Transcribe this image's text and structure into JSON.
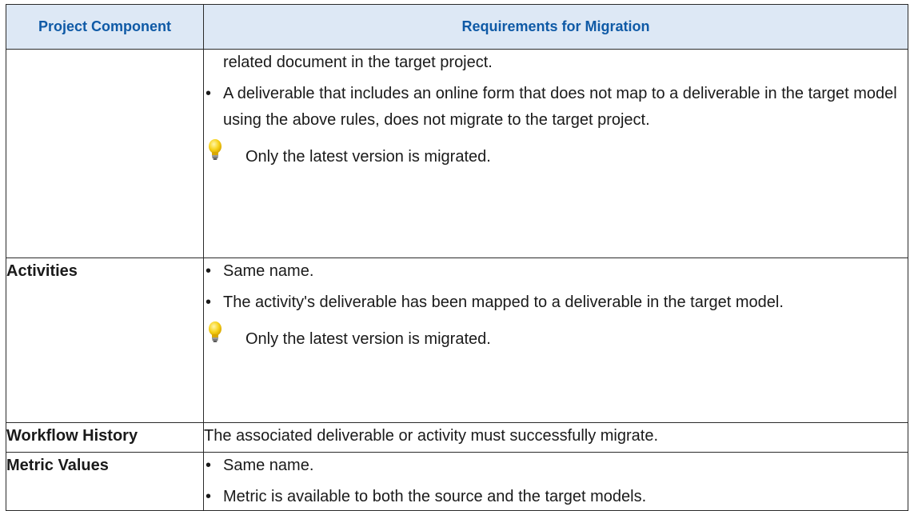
{
  "header": {
    "col_component": "Project Component",
    "col_requirements": "Requirements for Migration"
  },
  "rows": [
    {
      "component": "",
      "continued_text": "related document in the target project.",
      "bullets": [
        "A deliverable that includes an online form that does not map to a deliverable in the target model using the above rules, does not migrate to the target project."
      ],
      "tip": "Only the latest version is migrated."
    },
    {
      "component": "Activities",
      "bullets": [
        "Same name.",
        "The activity's deliverable has been mapped to a deliverable in the target model."
      ],
      "tip": "Only the latest version is migrated."
    },
    {
      "component": "Workflow History",
      "text": "The associated deliverable or activity must successfully migrate."
    },
    {
      "component": "Metric Values",
      "bullets": [
        "Same name.",
        "Metric is available to both the source and the target models."
      ]
    }
  ],
  "bullet_glyph": "•",
  "icons": {
    "tip": "lightbulb-icon"
  },
  "colors": {
    "header_bg": "#dde8f5",
    "header_text": "#0f5aa6",
    "border": "#2a2a2a",
    "bulb": "#f5c400"
  }
}
